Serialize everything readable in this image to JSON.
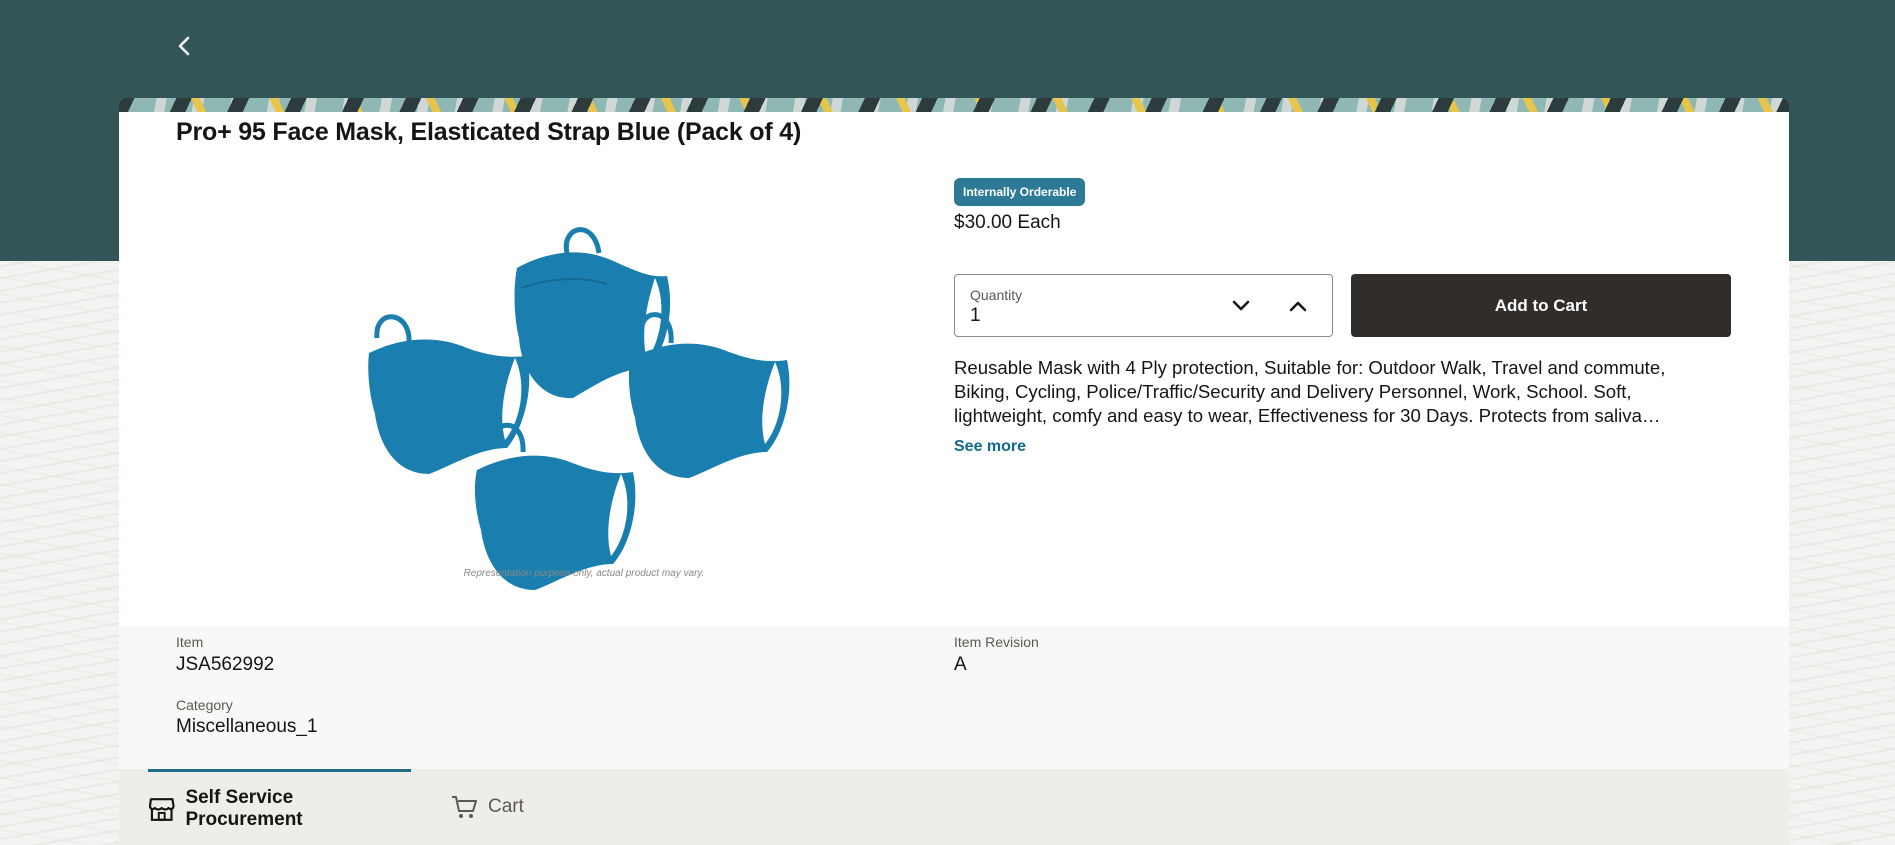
{
  "header": {
    "back_icon": "chevron-left-icon"
  },
  "product": {
    "title": "Pro+ 95 Face Mask, Elasticated Strap Blue (Pack of 4)",
    "badge": "Internally Orderable",
    "price": "$30.00 Each",
    "image_caption": "Representation purpose only, actual product may vary.",
    "description": "Reusable Mask with 4 Ply protection, Suitable for: Outdoor Walk, Travel and commute, Biking, Cycling, Police/Traffic/Security and Delivery Personnel, Work, School. Soft, lightweight, comfy and easy to wear, Effectiveness for 30 Days. Protects from saliva…",
    "see_more": "See more",
    "mask_color": "#1a7fae"
  },
  "quantity": {
    "label": "Quantity",
    "value": "1",
    "decrease_icon": "chevron-down-icon",
    "increase_icon": "chevron-up-icon"
  },
  "add_to_cart": "Add to Cart",
  "details": {
    "item_label": "Item",
    "item_value": "JSA562992",
    "revision_label": "Item Revision",
    "revision_value": "A",
    "category_label": "Category",
    "category_value": "Miscellaneous_1"
  },
  "tabs": [
    {
      "label": "Self Service Procurement",
      "icon": "store-icon",
      "active": true
    },
    {
      "label": "Cart",
      "icon": "cart-icon",
      "active": false
    }
  ],
  "colors": {
    "header_band": "#325558",
    "badge": "#2d7a96",
    "primary_button": "#312d2a",
    "link": "#0f6a8c",
    "active_tab_indicator": "#1f6d86"
  }
}
